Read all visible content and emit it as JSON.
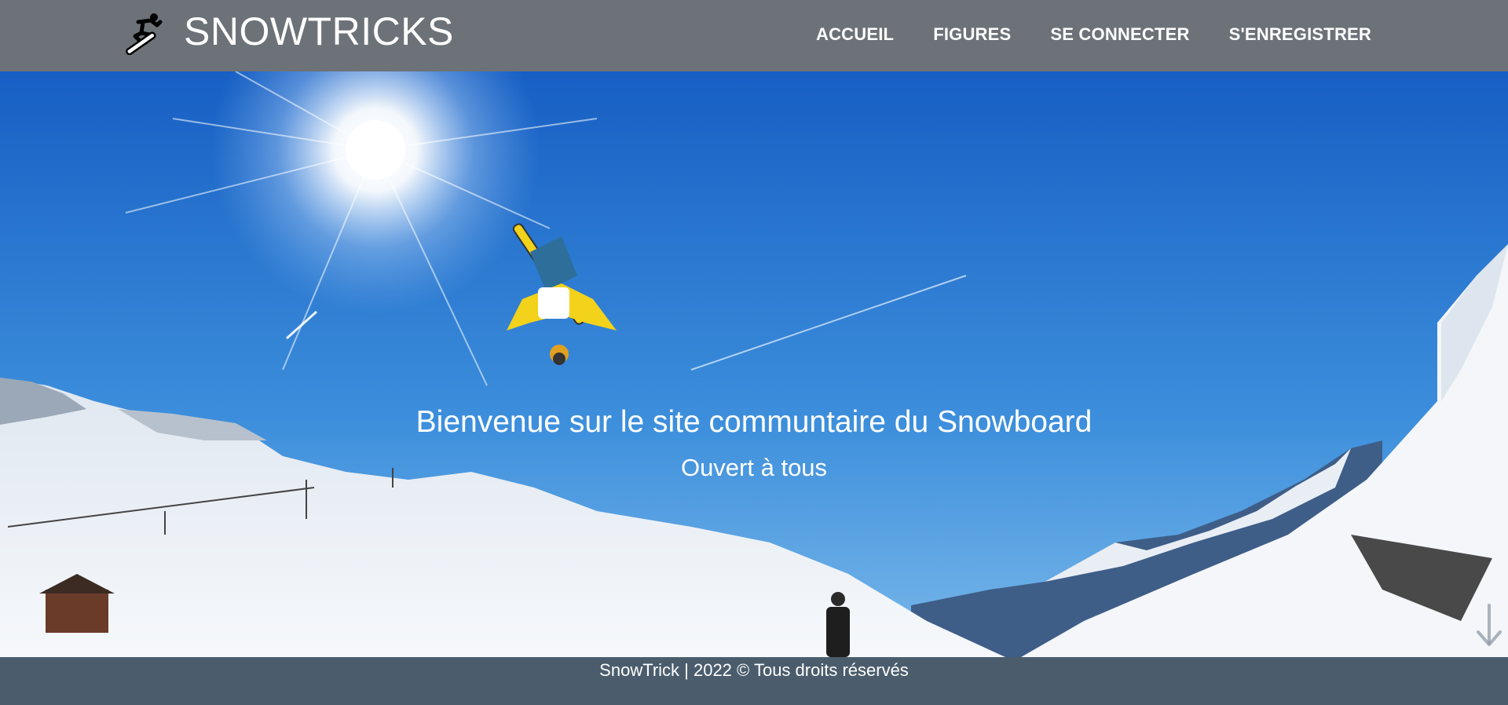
{
  "header": {
    "brand_title": "SNOWTRICKS",
    "logo_icon": "snowboarder-icon",
    "nav": {
      "home": "ACCUEIL",
      "tricks": "FIGURES",
      "login": "SE CONNECTER",
      "register": "S'ENREGISTRER"
    }
  },
  "hero": {
    "title": "Bienvenue sur le site communtaire du Snowboard",
    "subtitle": "Ouvert à tous",
    "scroll_icon": "arrow-down-icon"
  },
  "footer": {
    "copyright": "SnowTrick | 2022 © Tous droits réservés"
  },
  "colors": {
    "header_bg": "#6c7278",
    "footer_bg": "#4b5d6d",
    "sky_top": "#1a64c8",
    "sky_bottom": "#5aa6e6",
    "snow": "#f2f5f9"
  }
}
